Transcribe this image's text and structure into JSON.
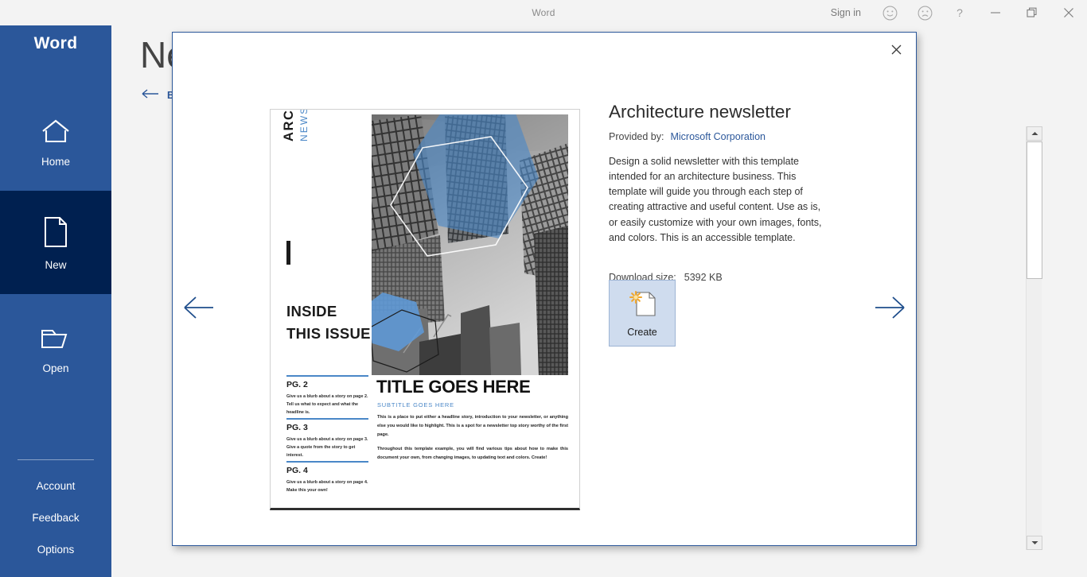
{
  "titlebar": {
    "app_name": "Word",
    "sign_in": "Sign in",
    "icons": {
      "smile": "smiley-face-icon",
      "frown": "frowny-face-icon",
      "help": "?",
      "minimize": "minimize-icon",
      "restore": "restore-icon",
      "close": "close-icon"
    }
  },
  "sidebar": {
    "brand": "Word",
    "items": [
      {
        "label": "Home",
        "icon": "home-icon",
        "selected": false
      },
      {
        "label": "New",
        "icon": "new-document-icon",
        "selected": true
      },
      {
        "label": "Open",
        "icon": "open-folder-icon",
        "selected": false
      }
    ],
    "links": [
      {
        "label": "Account"
      },
      {
        "label": "Feedback"
      },
      {
        "label": "Options"
      }
    ],
    "background_color": "#2b579a",
    "selected_color": "#002050"
  },
  "background_page": {
    "title": "New",
    "back_label": "Back"
  },
  "dialog": {
    "close_label": "Close",
    "prev_arrow": "previous-template",
    "next_arrow": "next-template",
    "border_color": "#2b579a"
  },
  "detail": {
    "title": "Architecture newsletter",
    "provided_by_label": "Provided by:",
    "provider": "Microsoft Corporation",
    "description": "Design a solid newsletter with this template intended for an architecture business. This template will guide you through each step of creating attractive and useful content. Use as is, or easily customize with your own images, fonts, and colors. This is an accessible template.",
    "download_size_label": "Download size:",
    "download_size_value": "5392 KB",
    "create_label": "Create",
    "create_icon": "new-document-sparkle-icon",
    "link_color": "#2b579a"
  },
  "template_preview": {
    "vertical_title": "ARCHITECTURE",
    "vertical_subtitle": "NEWSLETTER",
    "inside_heading": "INSIDE THIS ISSUE",
    "sections": [
      {
        "page": "PG. 2",
        "blurb": "Give us a blurb about a story on page 2.  Tell us what to expect and what the headline is."
      },
      {
        "page": "PG. 3",
        "blurb": "Give us a blurb about a story on page 3.  Give a quote from the story to get interest."
      },
      {
        "page": "PG. 4",
        "blurb": "Give us a blurb about a story on page 4.  Make this your own!"
      }
    ],
    "title": "TITLE GOES HERE",
    "subtitle": "SUBTITLE GOES HERE",
    "body_paragraphs": [
      "This is a place to put either a headline story, introduction to your newsletter, or anything else you would like to highlight.  This is a spot for a newsletter top story worthy of the first page.",
      "Throughout this template example, you will find various tips about how to make this document your own, from changing images, to updating text and colors.  Create!"
    ],
    "accent_color": "#4a87c7",
    "photo_description": "grayscale-skyscrapers-photo-with-blue-hexagons"
  },
  "scrollbar": {
    "up_arrow": "scroll-up-icon",
    "down_arrow": "scroll-down-icon"
  }
}
